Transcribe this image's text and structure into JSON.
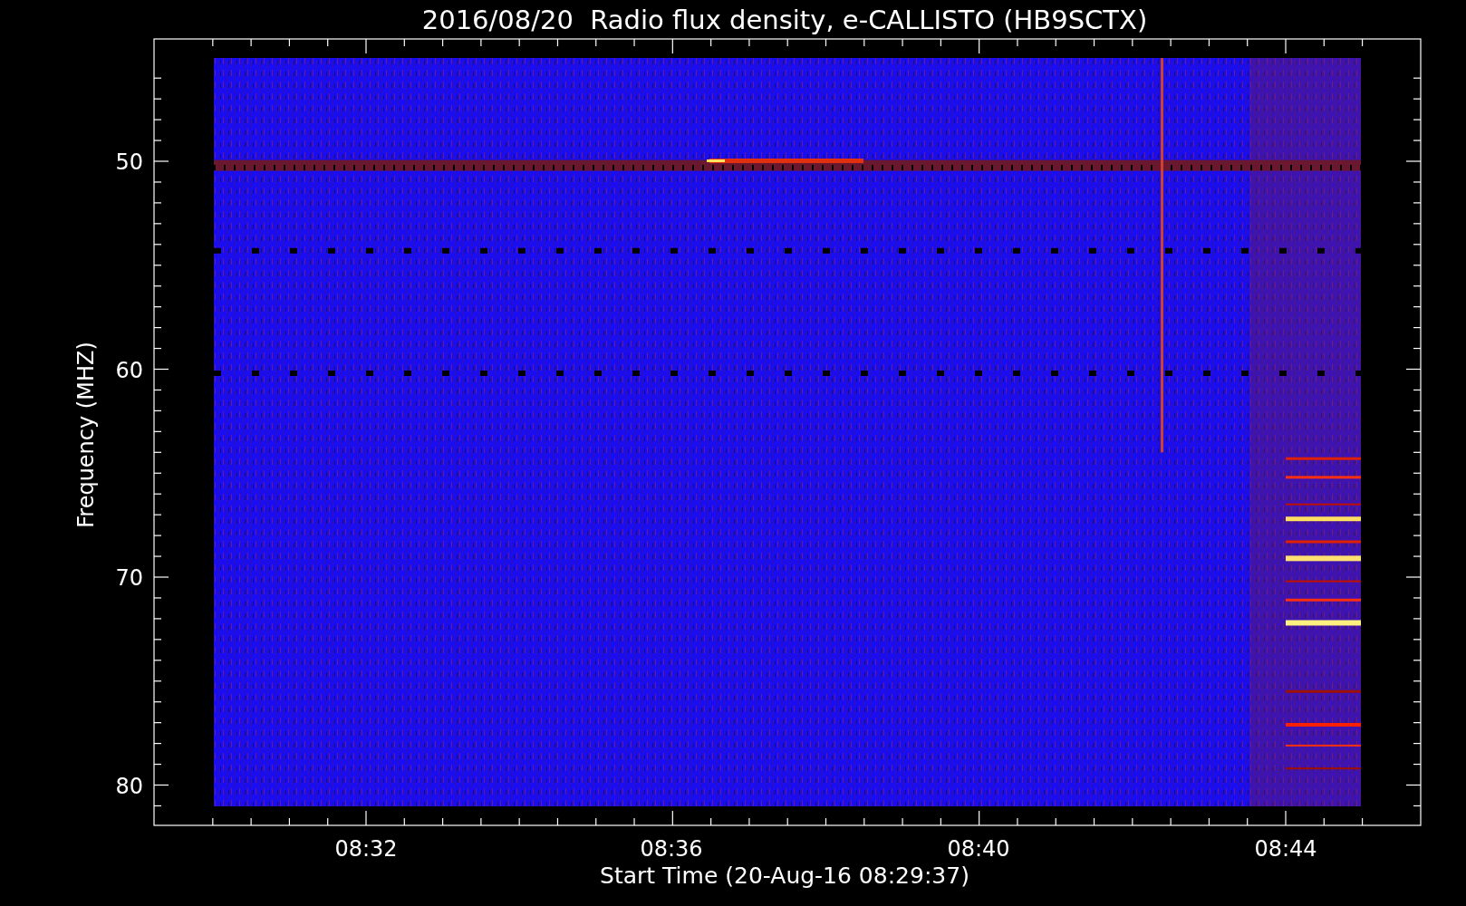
{
  "title": "2016/08/20  Radio flux density, e-CALLISTO (HB9SCTX)",
  "x_axis": {
    "label": "Start Time (20-Aug-16 08:29:37)",
    "ticks": [
      "08:32",
      "08:36",
      "08:40",
      "08:44"
    ]
  },
  "y_axis": {
    "label": "Frequency (MHZ)",
    "ticks": [
      "50",
      "60",
      "70",
      "80"
    ]
  }
}
